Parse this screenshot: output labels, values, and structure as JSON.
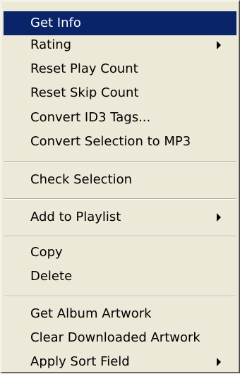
{
  "menu": {
    "items": [
      {
        "label": "Get Info",
        "highlighted": true
      },
      {
        "label": "Rating",
        "submenu": true
      },
      {
        "label": "Reset Play Count"
      },
      {
        "label": "Reset Skip Count"
      },
      {
        "label": "Convert ID3 Tags..."
      },
      {
        "label": "Convert Selection to MP3"
      },
      {
        "label": "Check Selection"
      },
      {
        "label": "Add to Playlist",
        "submenu": true
      },
      {
        "label": "Copy"
      },
      {
        "label": "Delete"
      },
      {
        "label": "Get Album Artwork"
      },
      {
        "label": "Clear Downloaded Artwork"
      },
      {
        "label": "Apply Sort Field",
        "submenu": true
      }
    ]
  },
  "colors": {
    "menu_background": "#ece9d8",
    "highlight_background": "#0a246a",
    "highlight_text": "#ffffff",
    "text": "#000000",
    "separator_dark": "#aca899",
    "separator_light": "#ffffff"
  },
  "icons": {
    "submenu": "submenu-arrow-icon"
  }
}
